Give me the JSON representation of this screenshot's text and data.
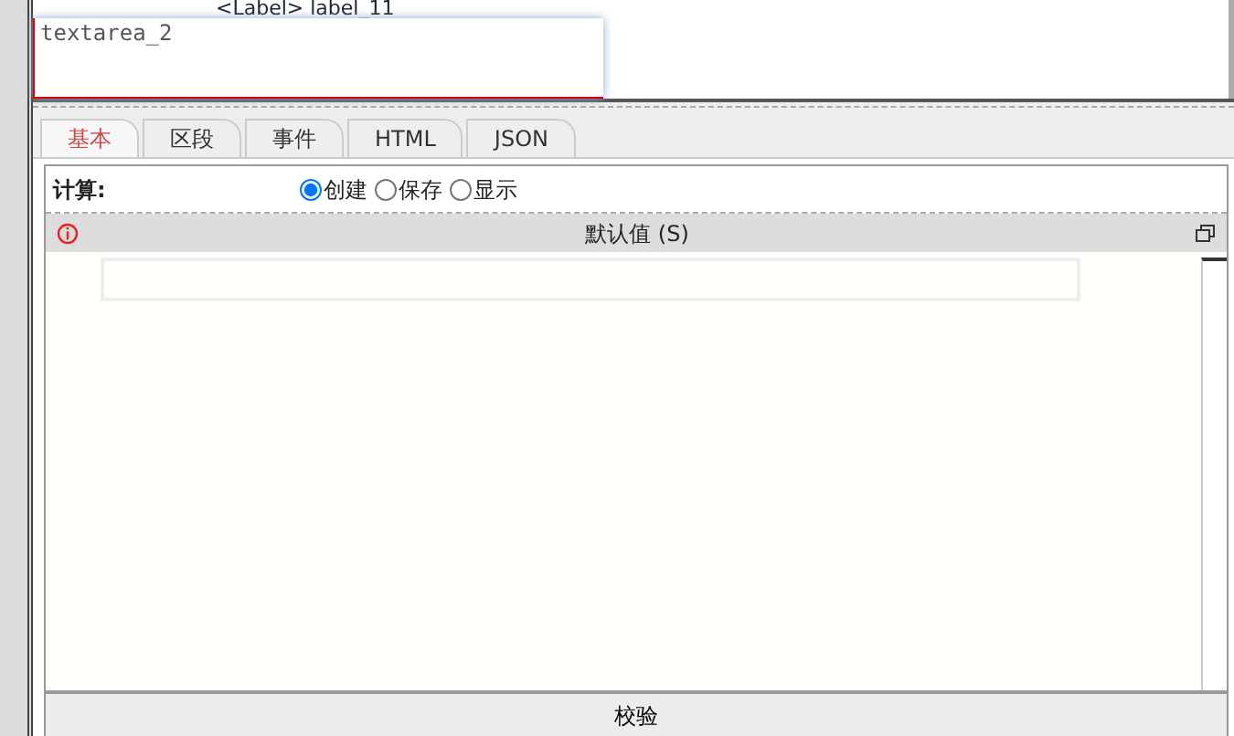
{
  "tree_item": {
    "text": "<Label> label_11"
  },
  "textarea": {
    "value": "textarea_2"
  },
  "tabs": [
    {
      "label": "基本",
      "selected": true
    },
    {
      "label": "区段",
      "selected": false
    },
    {
      "label": "事件",
      "selected": false
    },
    {
      "label": "HTML",
      "selected": false
    },
    {
      "label": "JSON",
      "selected": false
    }
  ],
  "calc": {
    "label": "计算:",
    "options": [
      {
        "label": "创建",
        "selected": true
      },
      {
        "label": "保存",
        "selected": false
      },
      {
        "label": "显示",
        "selected": false
      }
    ]
  },
  "editor": {
    "title": "默认值 (S)"
  },
  "footer": {
    "button": "校验"
  }
}
